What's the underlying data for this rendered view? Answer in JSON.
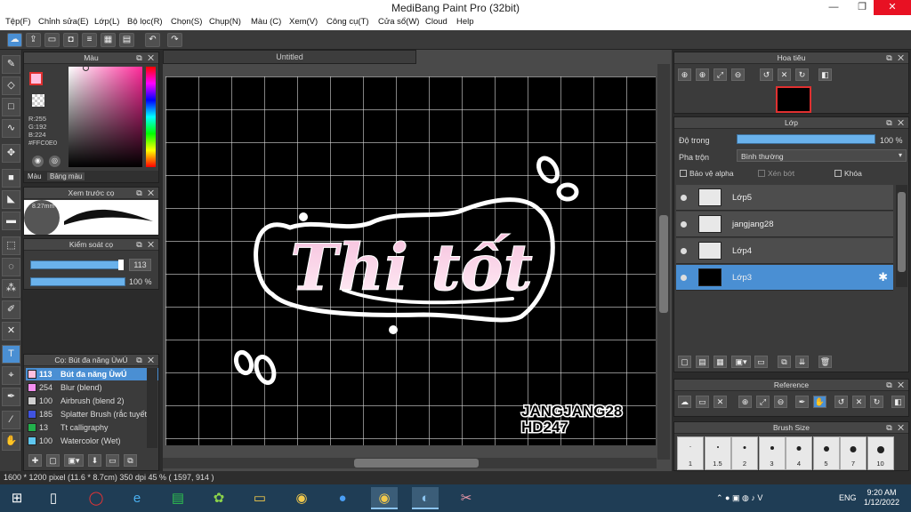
{
  "window": {
    "title": "MediBang Paint Pro (32bit)"
  },
  "menu": [
    "Tệp(F)",
    "Chỉnh sửa(E)",
    "Lớp(L)",
    "Bộ lọc(R)",
    "Chọn(S)",
    "Chụp(N)",
    "Màu (C)",
    "Xem(V)",
    "Công cụ(T)",
    "Cửa sổ(W)",
    "Cloud",
    "Help"
  ],
  "color_panel": {
    "title": "Màu",
    "r": "R:255",
    "g": "G:192",
    "b": "B:224",
    "hex": "#FFC0E0",
    "tabs": [
      "Màu",
      "Bảng màu"
    ],
    "primary_color": "#ffc0e0"
  },
  "brush_preview": {
    "title": "Xem trước cọ",
    "size_label": "8.27mm"
  },
  "brush_control": {
    "title": "Kiểm soát cọ",
    "size_value": "113",
    "opacity_value": "100 %",
    "size_fraction": 0.95,
    "opacity_fraction": 1.0
  },
  "brush_list": {
    "title": "Cọ: Bút đa năng ÙwÚ",
    "items": [
      {
        "size": "113",
        "name": "Bút đa năng ÙwÚ",
        "color": "#ffc0e0",
        "selected": true
      },
      {
        "size": "254",
        "name": "Blur (blend)",
        "color": "#f48ff0"
      },
      {
        "size": "100",
        "name": "Airbrush (blend 2)",
        "color": "#d0d0d0"
      },
      {
        "size": "185",
        "name": "Splatter Brush (rắc tuyết)",
        "color": "#4053e0"
      },
      {
        "size": "13",
        "name": "Tt calligraphy",
        "color": "#22b14c"
      },
      {
        "size": "100",
        "name": "Watercolor (Wet)",
        "color": "#5fc7f0"
      }
    ]
  },
  "canvas": {
    "tab_title": "Untitled",
    "artwork_text": "Thi tốt",
    "signature_1": "JANGJANG28",
    "signature_2": "HD247"
  },
  "navigator": {
    "title": "Hoa tiêu"
  },
  "layers": {
    "title": "Lớp",
    "opacity_label": "Độ trong",
    "opacity_value": "100 %",
    "opacity_fraction": 1.0,
    "blend_label": "Pha trộn",
    "blend_value": "Bình thường",
    "protect_alpha": "Bảo vệ alpha",
    "clipping": "Xén bớt",
    "lock": "Khóa",
    "items": [
      {
        "name": "Lớp5",
        "thumb": "white"
      },
      {
        "name": "jangjang28",
        "thumb": "white"
      },
      {
        "name": "Lớp4",
        "thumb": "white"
      },
      {
        "name": "Lớp3",
        "thumb": "black",
        "selected": true
      }
    ]
  },
  "reference": {
    "title": "Reference"
  },
  "brush_size_panel": {
    "title": "Brush Size",
    "sizes": [
      "1",
      "1.5",
      "2",
      "3",
      "4",
      "5",
      "7",
      "10"
    ]
  },
  "status": {
    "text": "1600 * 1200 pixel   (11.6 * 8.7cm)   350 dpi   45 %   ( 1597, 914 )"
  },
  "taskbar": {
    "time": "9:20 AM",
    "date": "1/12/2022",
    "lang": "ENG"
  }
}
